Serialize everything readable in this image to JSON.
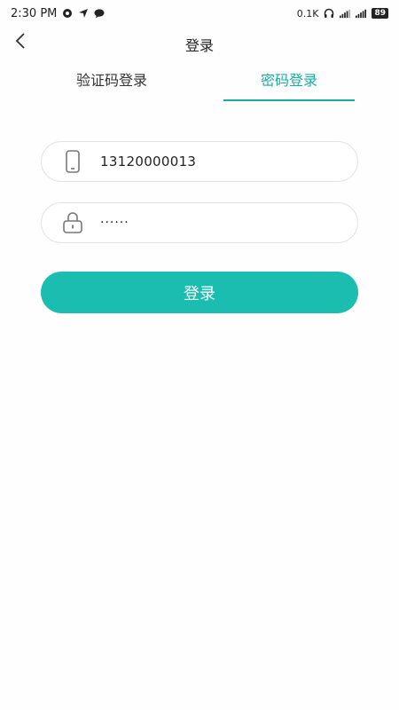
{
  "status_bar": {
    "time": "2:30 PM",
    "net_speed": "0.1K",
    "battery": "89",
    "icons": [
      "notification-icon",
      "location-arrow-icon",
      "message-icon",
      "headphones-icon",
      "signal-icon",
      "signal-icon-2"
    ]
  },
  "header": {
    "back_icon": "chevron-left-icon",
    "title": "登录"
  },
  "tabs": [
    {
      "label": "验证码登录",
      "active": false
    },
    {
      "label": "密码登录",
      "active": true
    }
  ],
  "form": {
    "phone": {
      "icon": "phone-icon",
      "value": "13120000013"
    },
    "password": {
      "icon": "lock-icon",
      "value": "······"
    },
    "submit_label": "登录"
  },
  "colors": {
    "accent": "#1bbdb1",
    "tab_active": "#1aada3",
    "field_border": "#e3e3e3"
  }
}
